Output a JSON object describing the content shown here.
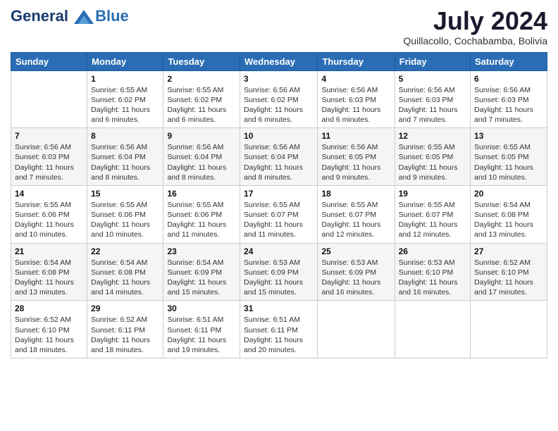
{
  "header": {
    "logo_line1": "General",
    "logo_line2": "Blue",
    "month": "July 2024",
    "location": "Quillacollo, Cochabamba, Bolivia"
  },
  "weekdays": [
    "Sunday",
    "Monday",
    "Tuesday",
    "Wednesday",
    "Thursday",
    "Friday",
    "Saturday"
  ],
  "weeks": [
    [
      {
        "day": "",
        "info": ""
      },
      {
        "day": "1",
        "info": "Sunrise: 6:55 AM\nSunset: 6:02 PM\nDaylight: 11 hours\nand 6 minutes."
      },
      {
        "day": "2",
        "info": "Sunrise: 6:55 AM\nSunset: 6:02 PM\nDaylight: 11 hours\nand 6 minutes."
      },
      {
        "day": "3",
        "info": "Sunrise: 6:56 AM\nSunset: 6:02 PM\nDaylight: 11 hours\nand 6 minutes."
      },
      {
        "day": "4",
        "info": "Sunrise: 6:56 AM\nSunset: 6:03 PM\nDaylight: 11 hours\nand 6 minutes."
      },
      {
        "day": "5",
        "info": "Sunrise: 6:56 AM\nSunset: 6:03 PM\nDaylight: 11 hours\nand 7 minutes."
      },
      {
        "day": "6",
        "info": "Sunrise: 6:56 AM\nSunset: 6:03 PM\nDaylight: 11 hours\nand 7 minutes."
      }
    ],
    [
      {
        "day": "7",
        "info": "Sunrise: 6:56 AM\nSunset: 6:03 PM\nDaylight: 11 hours\nand 7 minutes."
      },
      {
        "day": "8",
        "info": "Sunrise: 6:56 AM\nSunset: 6:04 PM\nDaylight: 11 hours\nand 8 minutes."
      },
      {
        "day": "9",
        "info": "Sunrise: 6:56 AM\nSunset: 6:04 PM\nDaylight: 11 hours\nand 8 minutes."
      },
      {
        "day": "10",
        "info": "Sunrise: 6:56 AM\nSunset: 6:04 PM\nDaylight: 11 hours\nand 8 minutes."
      },
      {
        "day": "11",
        "info": "Sunrise: 6:56 AM\nSunset: 6:05 PM\nDaylight: 11 hours\nand 9 minutes."
      },
      {
        "day": "12",
        "info": "Sunrise: 6:55 AM\nSunset: 6:05 PM\nDaylight: 11 hours\nand 9 minutes."
      },
      {
        "day": "13",
        "info": "Sunrise: 6:55 AM\nSunset: 6:05 PM\nDaylight: 11 hours\nand 10 minutes."
      }
    ],
    [
      {
        "day": "14",
        "info": "Sunrise: 6:55 AM\nSunset: 6:06 PM\nDaylight: 11 hours\nand 10 minutes."
      },
      {
        "day": "15",
        "info": "Sunrise: 6:55 AM\nSunset: 6:06 PM\nDaylight: 11 hours\nand 10 minutes."
      },
      {
        "day": "16",
        "info": "Sunrise: 6:55 AM\nSunset: 6:06 PM\nDaylight: 11 hours\nand 11 minutes."
      },
      {
        "day": "17",
        "info": "Sunrise: 6:55 AM\nSunset: 6:07 PM\nDaylight: 11 hours\nand 11 minutes."
      },
      {
        "day": "18",
        "info": "Sunrise: 6:55 AM\nSunset: 6:07 PM\nDaylight: 11 hours\nand 12 minutes."
      },
      {
        "day": "19",
        "info": "Sunrise: 6:55 AM\nSunset: 6:07 PM\nDaylight: 11 hours\nand 12 minutes."
      },
      {
        "day": "20",
        "info": "Sunrise: 6:54 AM\nSunset: 6:08 PM\nDaylight: 11 hours\nand 13 minutes."
      }
    ],
    [
      {
        "day": "21",
        "info": "Sunrise: 6:54 AM\nSunset: 6:08 PM\nDaylight: 11 hours\nand 13 minutes."
      },
      {
        "day": "22",
        "info": "Sunrise: 6:54 AM\nSunset: 6:08 PM\nDaylight: 11 hours\nand 14 minutes."
      },
      {
        "day": "23",
        "info": "Sunrise: 6:54 AM\nSunset: 6:09 PM\nDaylight: 11 hours\nand 15 minutes."
      },
      {
        "day": "24",
        "info": "Sunrise: 6:53 AM\nSunset: 6:09 PM\nDaylight: 11 hours\nand 15 minutes."
      },
      {
        "day": "25",
        "info": "Sunrise: 6:53 AM\nSunset: 6:09 PM\nDaylight: 11 hours\nand 16 minutes."
      },
      {
        "day": "26",
        "info": "Sunrise: 6:53 AM\nSunset: 6:10 PM\nDaylight: 11 hours\nand 16 minutes."
      },
      {
        "day": "27",
        "info": "Sunrise: 6:52 AM\nSunset: 6:10 PM\nDaylight: 11 hours\nand 17 minutes."
      }
    ],
    [
      {
        "day": "28",
        "info": "Sunrise: 6:52 AM\nSunset: 6:10 PM\nDaylight: 11 hours\nand 18 minutes."
      },
      {
        "day": "29",
        "info": "Sunrise: 6:52 AM\nSunset: 6:11 PM\nDaylight: 11 hours\nand 18 minutes."
      },
      {
        "day": "30",
        "info": "Sunrise: 6:51 AM\nSunset: 6:11 PM\nDaylight: 11 hours\nand 19 minutes."
      },
      {
        "day": "31",
        "info": "Sunrise: 6:51 AM\nSunset: 6:11 PM\nDaylight: 11 hours\nand 20 minutes."
      },
      {
        "day": "",
        "info": ""
      },
      {
        "day": "",
        "info": ""
      },
      {
        "day": "",
        "info": ""
      }
    ]
  ]
}
